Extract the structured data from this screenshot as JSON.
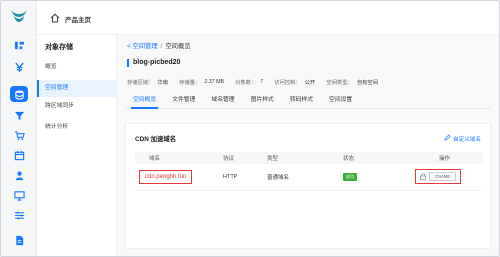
{
  "topbar": {
    "home_label": "产品主页"
  },
  "sidebar": {
    "title": "对象存储",
    "items": [
      {
        "label": "概览"
      },
      {
        "label": "空间管理"
      },
      {
        "label": "跨区域同步"
      },
      {
        "label": "统计分析"
      }
    ],
    "active_index": 1
  },
  "breadcrumb": {
    "parent": "空间管理",
    "separator": "/",
    "current": "空间概览"
  },
  "bucket": {
    "name": "blog-picbed20",
    "info": [
      {
        "label": "存储区域：",
        "value": "华南"
      },
      {
        "label": "存储量：",
        "value": "2.37 MB"
      },
      {
        "label": "对象数：",
        "value": "7"
      },
      {
        "label": "访问控制：",
        "value": "公开"
      },
      {
        "label": "空间类型：",
        "value": "自有空间"
      }
    ]
  },
  "tabs": [
    {
      "label": "空间概览"
    },
    {
      "label": "文件管理"
    },
    {
      "label": "域名管理"
    },
    {
      "label": "图片样式"
    },
    {
      "label": "转码样式"
    },
    {
      "label": "空间设置"
    }
  ],
  "cdn": {
    "title": "CDN 加速域名",
    "custom_label": "自定义域名",
    "columns": [
      "域名",
      "协议",
      "类型",
      "状态",
      "操作"
    ],
    "rows": [
      {
        "domain": "cdn.penghh.fun",
        "protocol": "HTTP",
        "type": "普通域名",
        "status": "成功",
        "action": "CNAME"
      }
    ]
  },
  "colors": {
    "accent": "#1677ff",
    "highlight": "#e23a3a",
    "success": "#38b13d"
  },
  "rail_icons": [
    "logo-icon",
    "blocks-icon",
    "yen-icon",
    "storage-icon",
    "filter-icon",
    "cart-icon",
    "calendar-icon",
    "person-icon",
    "monitor-icon",
    "sliders-icon",
    "list-icon",
    "document-icon"
  ]
}
